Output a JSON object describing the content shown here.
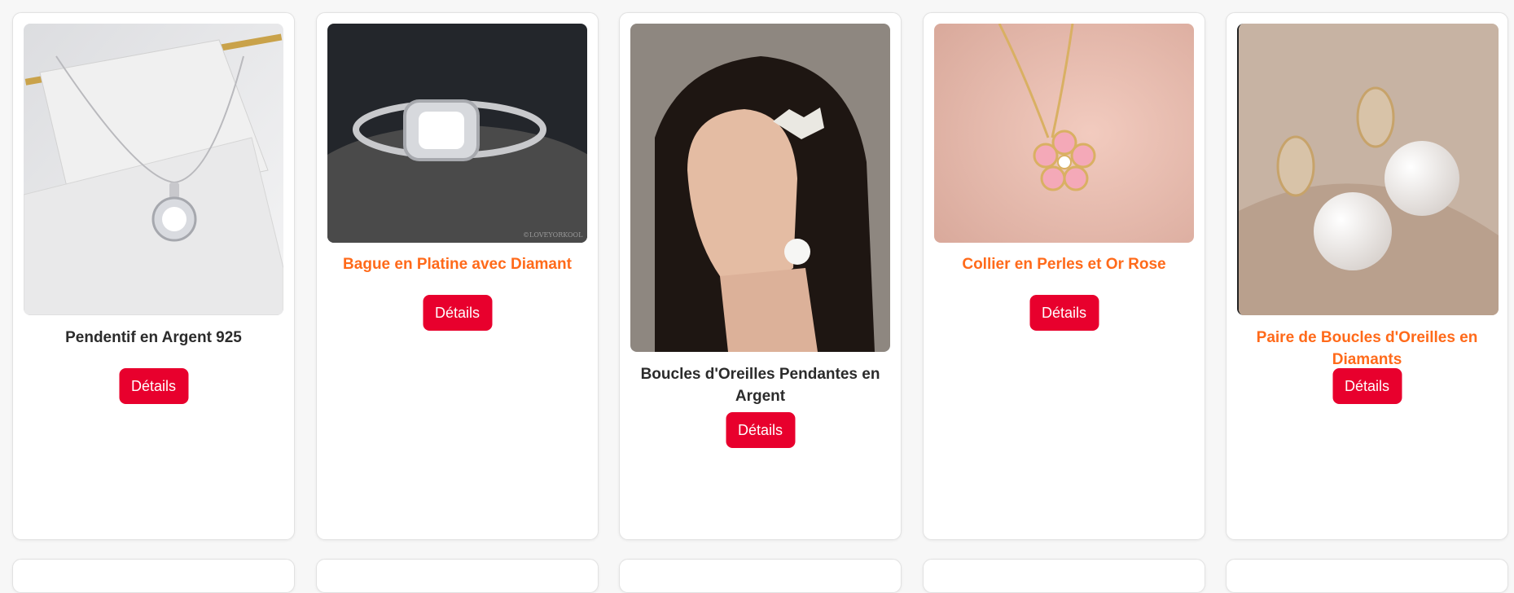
{
  "products": [
    {
      "title": "Pendentif en Argent 925",
      "button": "Détails",
      "image_icon": "silver-pendant-image"
    },
    {
      "title": "Bague en Platine avec Diamant",
      "button": "Détails",
      "image_icon": "platinum-ring-image",
      "watermark": "©LOVEYORKOOL"
    },
    {
      "title": "Boucles d'Oreilles Pendantes en Argent",
      "button": "Détails",
      "image_icon": "woman-earrings-image"
    },
    {
      "title": "Collier en Perles et Or Rose",
      "button": "Détails",
      "image_icon": "flower-necklace-image"
    },
    {
      "title": "Paire de Boucles d'Oreilles en Diamants",
      "button": "Détails",
      "image_icon": "pearl-earrings-image"
    }
  ],
  "colors": {
    "button": "#e8002d",
    "title_default": "#2b2b2b",
    "title_highlight": "#ff6a1a"
  }
}
